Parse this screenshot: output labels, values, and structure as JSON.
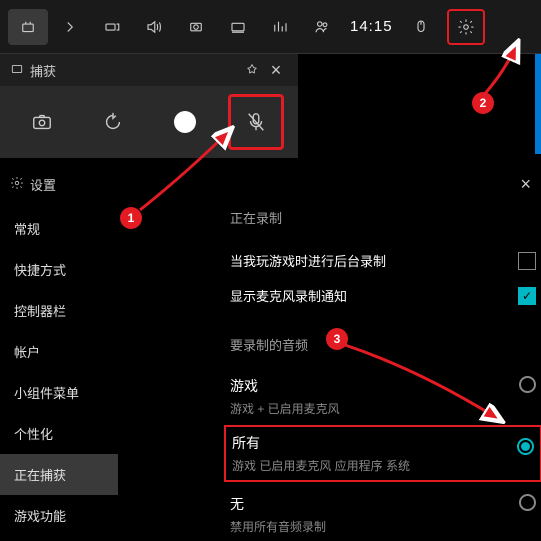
{
  "topbar": {
    "time": "14:15"
  },
  "widget": {
    "title": "捕获"
  },
  "settings": {
    "title": "设置"
  },
  "sidebar": {
    "items": [
      "常规",
      "快捷方式",
      "控制器栏",
      "帐户",
      "小组件菜单",
      "个性化",
      "正在捕获",
      "游戏功能"
    ],
    "selectedIndex": 6
  },
  "content": {
    "sect1_title": "正在录制",
    "row1_label": "当我玩游戏时进行后台录制",
    "row2_label": "显示麦克风录制通知",
    "sect2_title": "要录制的音频",
    "opt1_title": "游戏",
    "opt1_sub": "游戏 + 已启用麦克风",
    "opt2_title": "所有",
    "opt2_sub": "游戏   已启用麦克风   应用程序   系统",
    "opt3_title": "无",
    "opt3_sub": "禁用所有音频录制"
  },
  "badges": {
    "b1": "1",
    "b2": "2",
    "b3": "3"
  }
}
